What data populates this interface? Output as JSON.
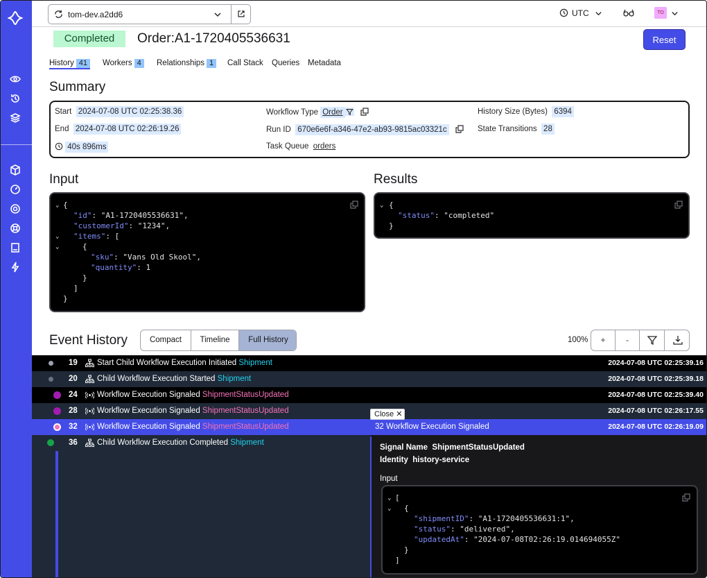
{
  "topbar": {
    "namespace": "tom-dev.a2dd6",
    "timezone": "UTC",
    "avatar_initials": "TO"
  },
  "header": {
    "status": "Completed",
    "title": "Order:A1-1720405536631",
    "reset_label": "Reset"
  },
  "tabs": [
    {
      "label": "History",
      "count": "41"
    },
    {
      "label": "Workers",
      "count": "4"
    },
    {
      "label": "Relationships",
      "count": "1"
    },
    {
      "label": "Call Stack",
      "count": ""
    },
    {
      "label": "Queries",
      "count": ""
    },
    {
      "label": "Metadata",
      "count": ""
    }
  ],
  "summary": {
    "title": "Summary",
    "start_label": "Start",
    "start_value": "2024-07-08 UTC 02:25:38.36",
    "end_label": "End",
    "end_value": "2024-07-08 UTC 02:26:19.26",
    "duration": "40s 896ms",
    "workflow_type_label": "Workflow Type",
    "workflow_type_value": "Order",
    "run_id_label": "Run ID",
    "run_id_value": "670e6e6f-a346-47e2-ab93-9815ac03321c",
    "task_queue_label": "Task Queue",
    "task_queue_value": "orders",
    "history_size_label": "History Size (Bytes)",
    "history_size_value": "6394",
    "state_transitions_label": "State Transitions",
    "state_transitions_value": "28"
  },
  "input": {
    "title": "Input",
    "lines": [
      {
        "t": "{"
      },
      {
        "k": "\"id\"",
        "v": ": \"A1-1720405536631\","
      },
      {
        "k": "\"customerId\"",
        "v": ": \"1234\","
      },
      {
        "k": "\"items\"",
        "v": ": ["
      },
      {
        "t": "{"
      },
      {
        "k": "\"sku\"",
        "v": ": \"Vans Old Skool\","
      },
      {
        "k": "\"quantity\"",
        "v": ": 1"
      },
      {
        "t": "}"
      },
      {
        "t": "]"
      },
      {
        "t": "}"
      }
    ]
  },
  "results": {
    "title": "Results",
    "lines": [
      {
        "t": "{"
      },
      {
        "k": "\"status\"",
        "v": ": \"completed\""
      },
      {
        "t": "}"
      }
    ]
  },
  "event_history": {
    "title": "Event History",
    "views": [
      "Compact",
      "Timeline",
      "Full History"
    ],
    "selected_view": "Full History",
    "zoom": "100%",
    "controls": [
      "+",
      "-"
    ],
    "events": [
      {
        "id": "19",
        "name": "Start Child Workflow Execution Initiated",
        "target": "Shipment",
        "target_kind": "workflow",
        "time": "2024-07-08 UTC 02:25:39.16",
        "dot": "#9ca3af",
        "bg": "#000000"
      },
      {
        "id": "20",
        "name": "Child Workflow Execution Started",
        "target": "Shipment",
        "target_kind": "workflow",
        "time": "2024-07-08 UTC 02:25:39.18",
        "dot": "#6b7280",
        "bg": "#1f2937"
      },
      {
        "id": "24",
        "name": "Workflow Execution Signaled",
        "target": "ShipmentStatusUpdated",
        "target_kind": "signal",
        "time": "2024-07-08 UTC 02:25:39.40",
        "dot": "#a21caf",
        "bg": "#000000"
      },
      {
        "id": "28",
        "name": "Workflow Execution Signaled",
        "target": "ShipmentStatusUpdated",
        "target_kind": "signal",
        "time": "2024-07-08 UTC 02:26:17.55",
        "dot": "#a21caf",
        "bg": "#1f2937"
      },
      {
        "id": "32",
        "name": "Workflow Execution Signaled",
        "target": "ShipmentStatusUpdated",
        "target_kind": "signal",
        "time": "2024-07-08 UTC 02:26:19.09",
        "dot": "#f472b6",
        "bg": "#444ce7"
      },
      {
        "id": "36",
        "name": "Child Workflow Execution Completed",
        "target": "Shipment",
        "target_kind": "workflow",
        "time": "",
        "dot": "#16a34a",
        "bg": "#1f2937"
      }
    ]
  },
  "detail": {
    "close_label": "Close",
    "header": "32 Workflow Execution Signaled",
    "signal_name_label": "Signal Name",
    "signal_name_value": "ShipmentStatusUpdated",
    "identity_label": "Identity",
    "identity_value": "history-service",
    "input_label": "Input",
    "lines": [
      {
        "t": "["
      },
      {
        "t": "{"
      },
      {
        "k": "\"shipmentID\"",
        "v": ": \"A1-1720405536631:1\","
      },
      {
        "k": "\"status\"",
        "v": ": \"delivered\","
      },
      {
        "k": "\"updatedAt\"",
        "v": ": \"2024-07-08T02:26:19.014694055Z\""
      },
      {
        "t": "}"
      },
      {
        "t": "]"
      }
    ]
  },
  "colors": {
    "accent": "#444ce7",
    "completed_bg": "#bbf7d0",
    "signal": "#f472b6",
    "workflow": "#22d3ee"
  }
}
